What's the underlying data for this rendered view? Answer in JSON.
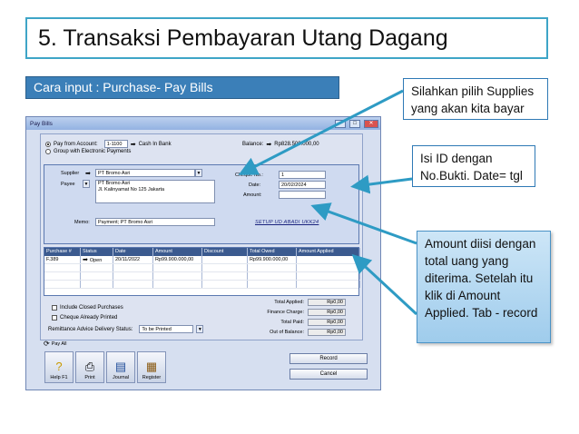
{
  "slide": {
    "title": "5.  Transaksi Pembayaran Utang Dagang",
    "subtitle": "Cara input : Purchase- Pay Bills",
    "callout_1": "Silahkan pilih Supplies yang akan kita bayar",
    "callout_2": "Isi ID dengan No.Bukti. Date= tgl",
    "callout_3": "Amount diisi dengan total uang yang diterima. Setelah itu klik di Amount Applied. Tab - record"
  },
  "colors": {
    "accent": "#3ea5c7",
    "banner": "#3b7fb8",
    "arrow": "#2e9bc4"
  },
  "window": {
    "title": "Pay Bills",
    "pay_from_label": "Pay from Account:",
    "account_no": "1-1100",
    "account_name": "Cash In Bank",
    "balance_label": "Balance:",
    "balance_value": "Rp828.500.000,00",
    "group_label": "Group with Electronic Payments",
    "supplier_label": "Supplier",
    "supplier_value": "PT Bromo Asri",
    "payee_label": "Payee",
    "payee_line1": "PT Bromo Asri",
    "payee_line2": "Jl. Kalinyamat No 125 Jakarta",
    "cheque_label": "Cheque No.:",
    "cheque_value": "1",
    "date_label": "Date:",
    "date_value": "20/02/2024",
    "amount_label": "Amount:",
    "amount_value": "",
    "memo_label": "Memo:",
    "memo_value": "Payment; PT Bromo Asri",
    "setup_text": "SETUP UD ABADI UKK24",
    "grid": {
      "headers": [
        "Purchase #",
        "Status",
        "Date",
        "Amount",
        "Discount",
        "Total Owed",
        "Amount Applied"
      ],
      "rows": [
        [
          "F.389",
          "Open",
          "20/11/2022",
          "Rp99.900.000,00",
          "",
          "Rp99.900.000,00",
          ""
        ]
      ]
    },
    "include_closed": "Include Closed Purchases",
    "cheque_printed": "Cheque Already Printed",
    "remittance_label": "Remittance Advice Delivery Status:",
    "remittance_value": "To be Printed",
    "totals": [
      {
        "label": "Total Applied:",
        "value": "Rp0,00"
      },
      {
        "label": "Finance Charge:",
        "value": "Rp0,00"
      },
      {
        "label": "Total Paid:",
        "value": "Rp0,00"
      },
      {
        "label": "Out of Balance:",
        "value": "Rp0,00"
      }
    ],
    "pay_all": "Pay All",
    "tools": [
      {
        "label": "Help F1",
        "icon": "help-icon"
      },
      {
        "label": "Print",
        "icon": "printer-icon"
      },
      {
        "label": "Journal",
        "icon": "journal-icon"
      },
      {
        "label": "Register",
        "icon": "register-icon"
      }
    ],
    "record_button": "Record",
    "cancel_button": "Cancel"
  }
}
